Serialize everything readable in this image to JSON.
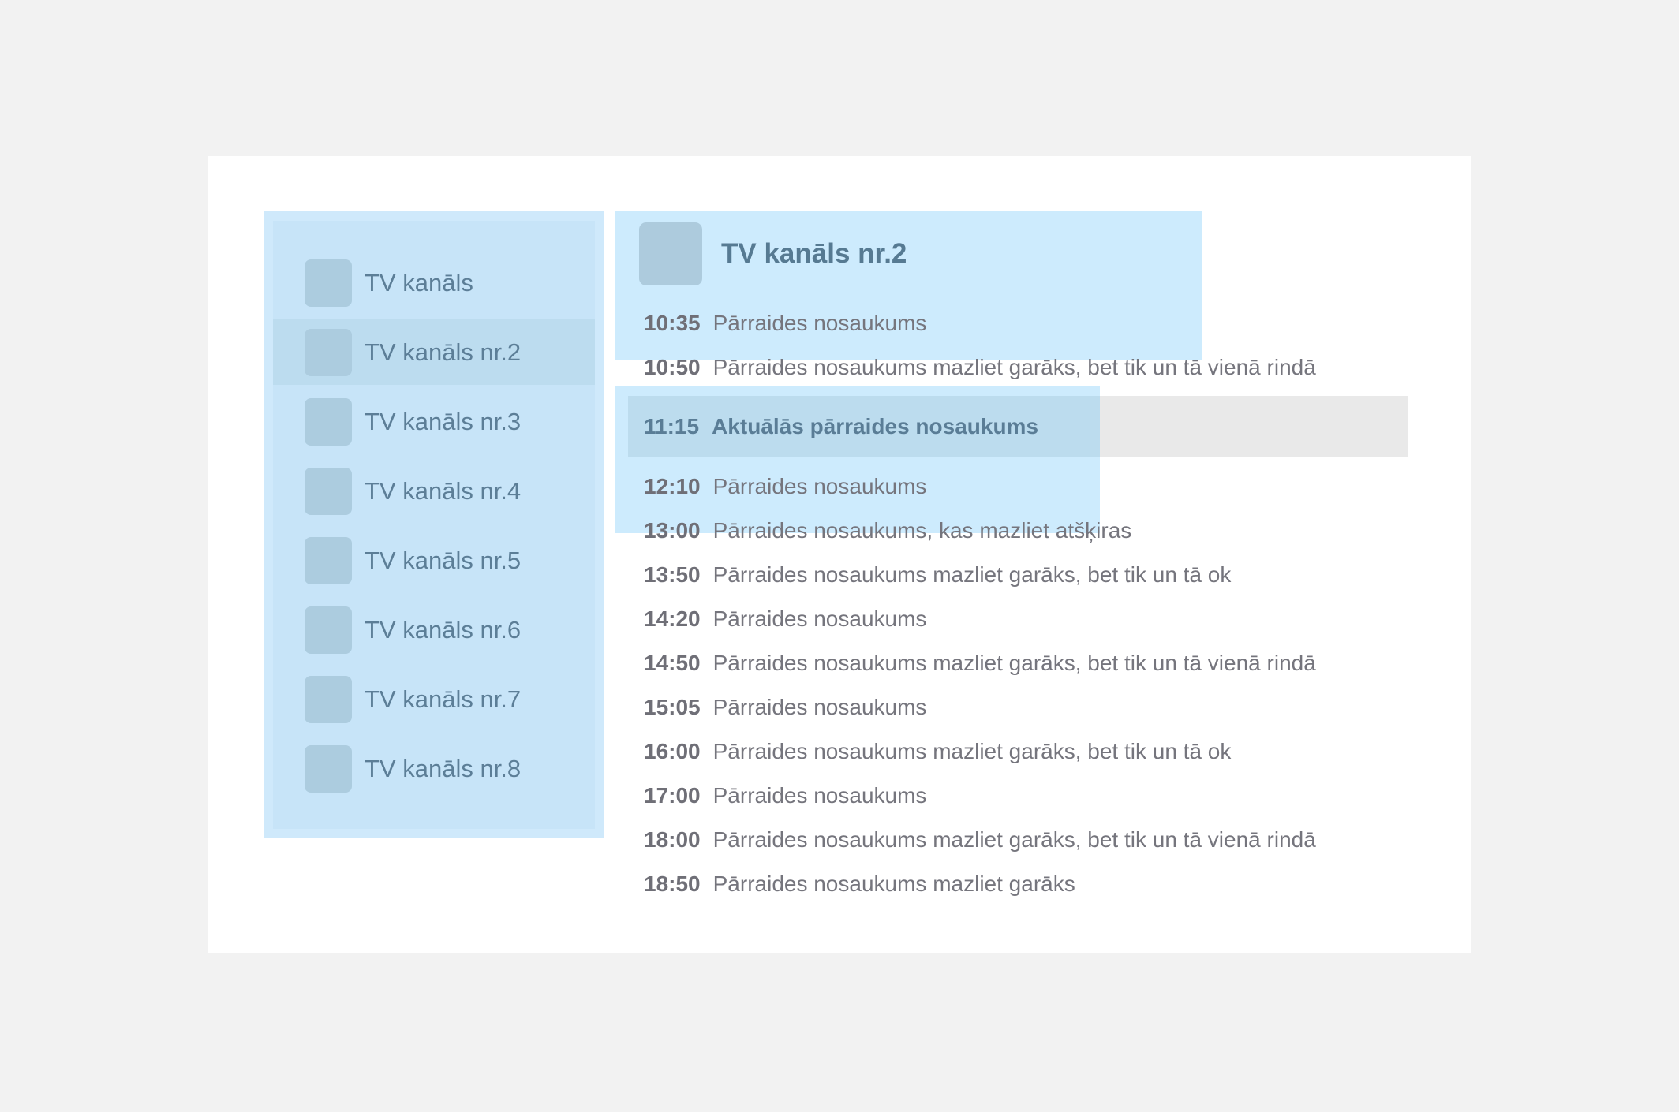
{
  "sidebar": {
    "channels": [
      {
        "label": "TV kanāls",
        "selected": false
      },
      {
        "label": "TV kanāls nr.2",
        "selected": true
      },
      {
        "label": "TV kanāls nr.3",
        "selected": false
      },
      {
        "label": "TV kanāls nr.4",
        "selected": false
      },
      {
        "label": "TV kanāls nr.5",
        "selected": false
      },
      {
        "label": "TV kanāls nr.6",
        "selected": false
      },
      {
        "label": "TV kanāls nr.7",
        "selected": false
      },
      {
        "label": "TV kanāls nr.8",
        "selected": false
      }
    ]
  },
  "main": {
    "channel_title": "TV kanāls nr.2",
    "schedule": [
      {
        "time": "10:35",
        "title": "Pārraides nosaukums",
        "current": false
      },
      {
        "time": "10:50",
        "title": "Pārraides nosaukums mazliet garāks, bet tik un tā vienā rindā",
        "current": false
      },
      {
        "time": "11:15",
        "title": "Aktuālās pārraides nosaukums",
        "current": true
      },
      {
        "time": "12:10",
        "title": "Pārraides nosaukums",
        "current": false
      },
      {
        "time": "13:00",
        "title": "Pārraides nosaukums, kas mazliet atšķiras",
        "current": false
      },
      {
        "time": "13:50",
        "title": "Pārraides nosaukums mazliet garāks, bet tik un tā ok",
        "current": false
      },
      {
        "time": "14:20",
        "title": "Pārraides nosaukums",
        "current": false
      },
      {
        "time": "14:50",
        "title": "Pārraides nosaukums mazliet garāks, bet tik un tā vienā rindā",
        "current": false
      },
      {
        "time": "15:05",
        "title": "Pārraides nosaukums",
        "current": false
      },
      {
        "time": "16:00",
        "title": "Pārraides nosaukums mazliet garāks, bet tik un tā ok",
        "current": false
      },
      {
        "time": "17:00",
        "title": "Pārraides nosaukums",
        "current": false
      },
      {
        "time": "18:00",
        "title": "Pārraides nosaukums mazliet garāks, bet tik un tā vienā rindā",
        "current": false
      },
      {
        "time": "18:50",
        "title": "Pārraides nosaukums mazliet garāks",
        "current": false
      }
    ]
  },
  "colors": {
    "page_background": "#f2f2f2",
    "card_background": "#ffffff",
    "highlight_blue": "#cdebfd",
    "selected_blue": "#bcdcef",
    "current_row_gray": "#e9e9e9",
    "text_gray": "#75757d",
    "text_blue": "#5a7d96"
  }
}
